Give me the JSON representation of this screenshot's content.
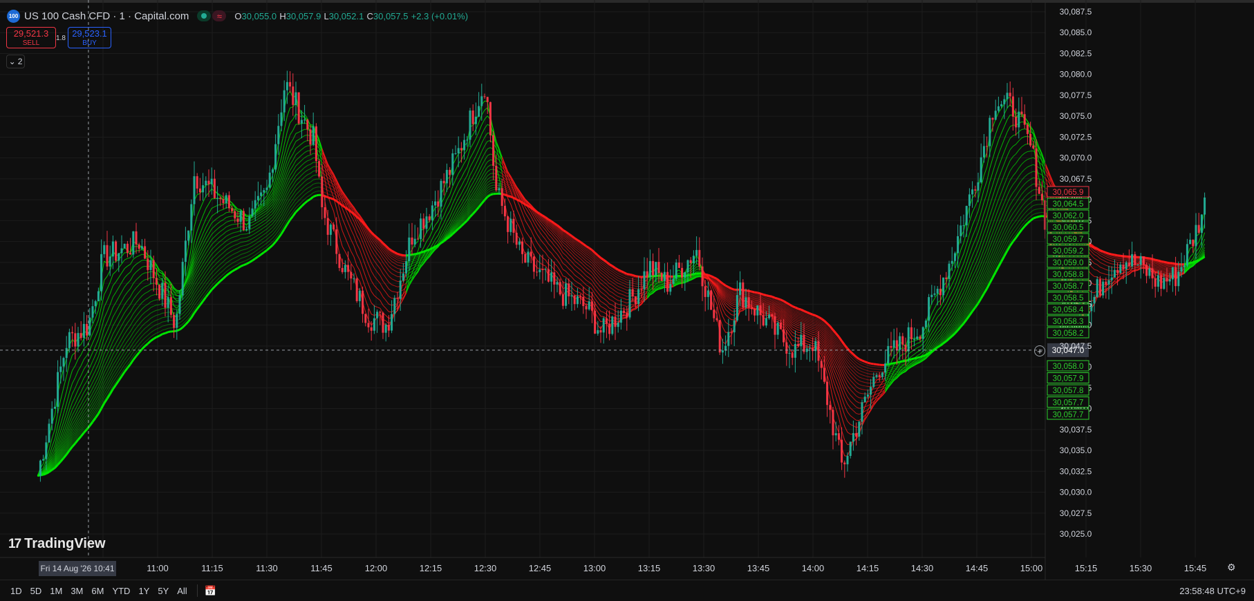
{
  "legend": {
    "badge": "100",
    "symbol": "US 100 Cash CFD · 1 · Capital.com",
    "ohlc": [
      {
        "k": "O",
        "v": "30,055.0"
      },
      {
        "k": "H",
        "v": "30,057.9"
      },
      {
        "k": "L",
        "v": "30,052.1"
      },
      {
        "k": "C",
        "v": "30,057.5"
      }
    ],
    "change": "+2.3 (+0.01%)"
  },
  "trade": {
    "sell_price": "29,521.3",
    "sell_label": "SELL",
    "spread": "1.8",
    "buy_price": "29,523.1",
    "buy_label": "BUY"
  },
  "indicators_count": "2",
  "brand": "TradingView",
  "crosshair": {
    "date_label": "Fri 14 Aug '26   10:41",
    "price_label": "30,047.0"
  },
  "time_ranges": [
    "1D",
    "5D",
    "1M",
    "3M",
    "6M",
    "YTD",
    "1Y",
    "5Y",
    "All"
  ],
  "clock": "23:58:48 UTC+9",
  "colors": {
    "bull": "#22ab94",
    "bear": "#f23645",
    "ribbon_up": "#00e600",
    "ribbon_down": "#ff1a1a",
    "background": "#0f0f0f"
  },
  "icons": {
    "collapse": "chevron-down-icon",
    "crosshair_add": "plus-circle-icon",
    "settings": "gear-icon",
    "date_range": "calendar-icon"
  },
  "chart_data": {
    "type": "line",
    "title": "",
    "xlabel": "",
    "ylabel": "",
    "ylim": [
      30022.5,
      30089.0
    ],
    "x_ticks": [
      "10:45",
      "11:00",
      "11:15",
      "11:30",
      "11:45",
      "12:00",
      "12:15",
      "12:30",
      "12:45",
      "13:00",
      "13:15",
      "13:30",
      "13:45",
      "14:00",
      "14:15",
      "14:30",
      "14:45",
      "15:00",
      "15:15",
      "15:30",
      "15:45"
    ],
    "y_ticks": [
      "30,025.0",
      "30,027.5",
      "30,030.0",
      "30,032.5",
      "30,035.0",
      "30,037.5",
      "30,040.0",
      "30,042.5",
      "30,045.0",
      "30,047.5",
      "30,050.0",
      "30,052.5",
      "30,055.0",
      "30,057.5",
      "30,060.0",
      "30,062.5",
      "30,065.0",
      "30,067.5",
      "30,070.0",
      "30,072.5",
      "30,075.0",
      "30,077.5",
      "30,080.0",
      "30,082.5",
      "30,085.0",
      "30,087.5"
    ],
    "price_x": [
      "10:27",
      "10:35",
      "10:41",
      "10:45",
      "10:55",
      "11:05",
      "11:10",
      "11:20",
      "11:25",
      "11:30",
      "11:35",
      "11:43",
      "11:45",
      "11:52",
      "11:58",
      "12:03",
      "12:10",
      "12:15",
      "12:22",
      "12:28",
      "12:30",
      "12:33",
      "12:40",
      "12:50",
      "12:58",
      "13:02",
      "13:10",
      "13:15",
      "13:20",
      "13:28",
      "13:32",
      "13:35",
      "13:40",
      "13:50",
      "13:55",
      "14:00",
      "14:04",
      "14:08",
      "14:12",
      "14:18",
      "14:25",
      "14:30",
      "14:38",
      "14:45",
      "14:50",
      "14:55",
      "15:00",
      "15:05",
      "15:10",
      "15:15",
      "15:20",
      "15:25",
      "15:30",
      "15:35",
      "15:40",
      "15:45",
      "15:48"
    ],
    "price_y": [
      30032,
      30048,
      30050,
      30058,
      30060,
      30050,
      30068,
      30064,
      30062,
      30066,
      30079,
      30072,
      30064,
      30056,
      30051,
      30050,
      30061,
      30064,
      30070,
      30077,
      30079,
      30066,
      30058,
      30054,
      30052,
      30049,
      30053,
      30057,
      30055,
      30059,
      30052,
      30047,
      30054,
      30049,
      30047,
      30048,
      30041,
      30033,
      30038,
      30045,
      30048,
      30050,
      30058,
      30068,
      30077,
      30076,
      30071,
      30060,
      30055,
      30051,
      30056,
      30058,
      30057,
      30055,
      30056,
      30061,
      30065
    ],
    "ribbon_labels_green": [
      "30,064.5",
      "30,062.0",
      "30,060.5",
      "30,059.7",
      "30,059.2",
      "30,059.0",
      "30,058.8",
      "30,058.7",
      "30,058.5",
      "30,058.4",
      "30,058.3",
      "30,058.2"
    ],
    "ribbon_labels_green_low": [
      "30,058.0",
      "30,057.9",
      "30,057.8",
      "30,057.7",
      "30,057.7"
    ],
    "ribbon_label_red": "30,065.9",
    "partial_label": "30,062.5"
  }
}
